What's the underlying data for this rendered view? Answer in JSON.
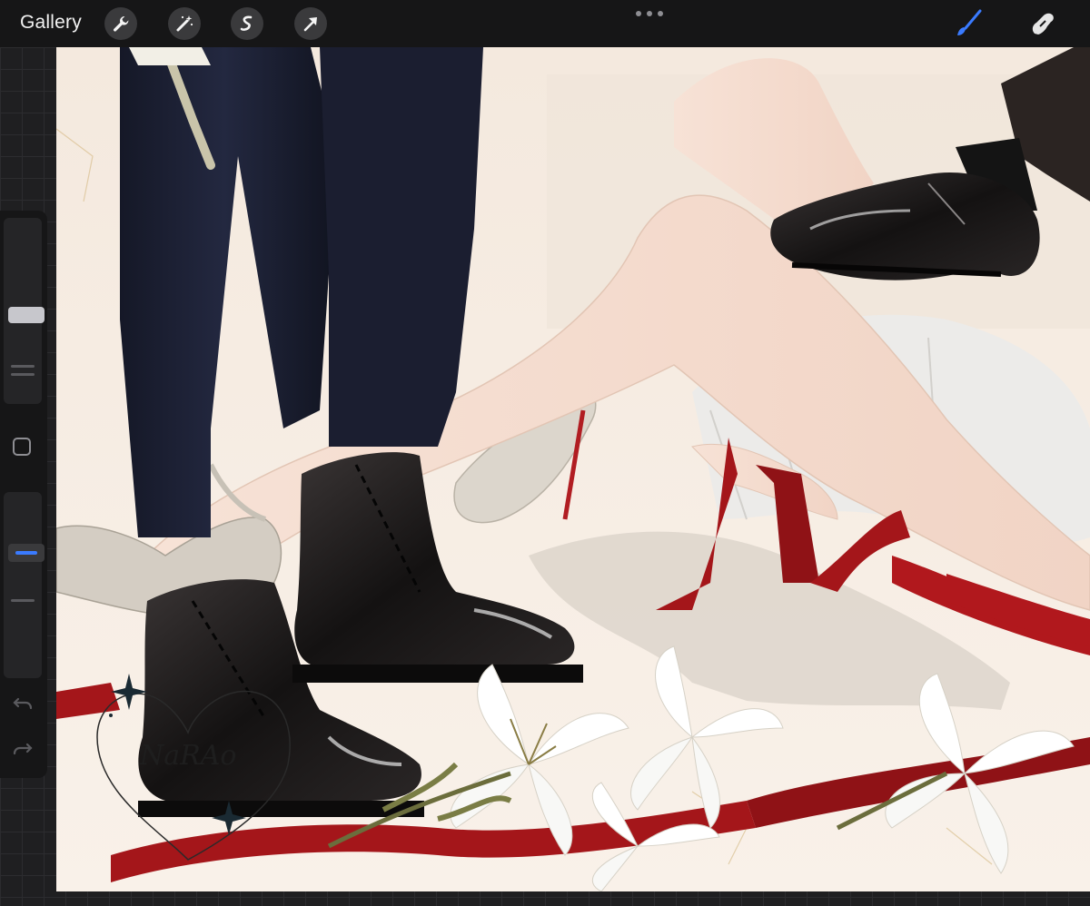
{
  "toolbar": {
    "gallery_label": "Gallery",
    "left_tools": [
      "wrench-icon",
      "magic-wand-icon",
      "selection-icon",
      "transform-arrow-icon"
    ],
    "right_tools": [
      "brush-icon",
      "smudge-icon"
    ],
    "more_menu": "more-dots-icon",
    "active_tool_color": "#3a7bff"
  },
  "sidebar": {
    "brush_size_level": 0.5,
    "opacity_level": 0.3,
    "modify_button": "square-icon",
    "undo": "undo-icon",
    "redo": "redo-icon"
  },
  "canvas": {
    "signature_text": "NaRAo",
    "accent_red": "#a4161a",
    "background_cream": "#f6ece2"
  }
}
